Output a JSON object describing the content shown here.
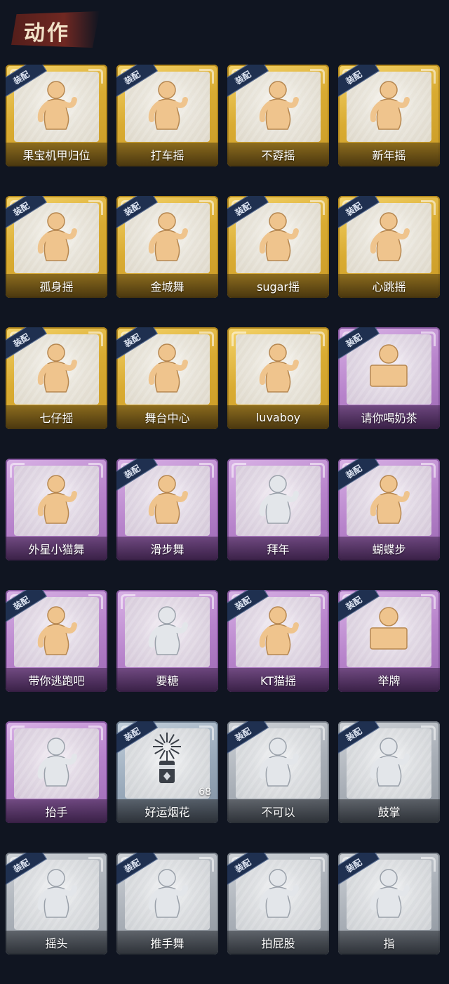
{
  "header": {
    "title": "动作"
  },
  "badge_label": "装配",
  "cards": [
    {
      "label": "果宝机甲归位",
      "tier": "gold",
      "equipped": true,
      "icon": "dance-figure-icon"
    },
    {
      "label": "打车摇",
      "tier": "gold",
      "equipped": true,
      "icon": "dance-figure-icon"
    },
    {
      "label": "不孬摇",
      "tier": "gold",
      "equipped": true,
      "icon": "dance-figure-icon"
    },
    {
      "label": "新年摇",
      "tier": "gold",
      "equipped": true,
      "icon": "dance-figure-icon"
    },
    {
      "label": "孤身摇",
      "tier": "gold",
      "equipped": true,
      "icon": "dance-figure-icon"
    },
    {
      "label": "金城舞",
      "tier": "gold",
      "equipped": true,
      "icon": "dance-figure-icon"
    },
    {
      "label": "sugar摇",
      "tier": "gold",
      "equipped": true,
      "icon": "dance-figure-icon"
    },
    {
      "label": "心跳摇",
      "tier": "gold",
      "equipped": true,
      "icon": "dance-figure-icon"
    },
    {
      "label": "七仔摇",
      "tier": "gold",
      "equipped": true,
      "icon": "dance-figure-icon"
    },
    {
      "label": "舞台中心",
      "tier": "gold",
      "equipped": true,
      "icon": "dance-figure-icon"
    },
    {
      "label": "luvaboy",
      "tier": "gold",
      "equipped": false,
      "icon": "dance-figure-icon"
    },
    {
      "label": "请你喝奶茶",
      "tier": "purple",
      "equipped": true,
      "icon": "sign-figure-icon"
    },
    {
      "label": "外星小猫舞",
      "tier": "purple",
      "equipped": false,
      "icon": "dance-figure-icon"
    },
    {
      "label": "滑步舞",
      "tier": "purple",
      "equipped": true,
      "icon": "dance-figure-icon"
    },
    {
      "label": "拜年",
      "tier": "purple",
      "equipped": false,
      "icon": "bow-figure-icon"
    },
    {
      "label": "蝴蝶步",
      "tier": "purple",
      "equipped": true,
      "icon": "dance-figure-icon"
    },
    {
      "label": "带你逃跑吧",
      "tier": "purple",
      "equipped": true,
      "icon": "dance-figure-icon"
    },
    {
      "label": "要糖",
      "tier": "purple",
      "equipped": false,
      "icon": "ask-figure-icon"
    },
    {
      "label": "KT猫摇",
      "tier": "purple",
      "equipped": true,
      "icon": "dance-figure-icon"
    },
    {
      "label": "举牌",
      "tier": "purple",
      "equipped": true,
      "icon": "sign-figure-icon"
    },
    {
      "label": "抬手",
      "tier": "purple",
      "equipped": false,
      "icon": "raise-hand-icon"
    },
    {
      "label": "好运烟花",
      "tier": "bluegray",
      "equipped": true,
      "icon": "firework-icon",
      "count": "68"
    },
    {
      "label": "不可以",
      "tier": "gray",
      "equipped": true,
      "icon": "finger-wag-icon"
    },
    {
      "label": "鼓掌",
      "tier": "gray",
      "equipped": true,
      "icon": "clap-icon"
    },
    {
      "label": "摇头",
      "tier": "gray",
      "equipped": true,
      "icon": "shake-head-icon"
    },
    {
      "label": "推手舞",
      "tier": "gray",
      "equipped": true,
      "icon": "push-hand-icon"
    },
    {
      "label": "拍屁股",
      "tier": "gray",
      "equipped": true,
      "icon": "pat-icon"
    },
    {
      "label": "指",
      "tier": "gray",
      "equipped": true,
      "icon": "point-icon"
    }
  ]
}
